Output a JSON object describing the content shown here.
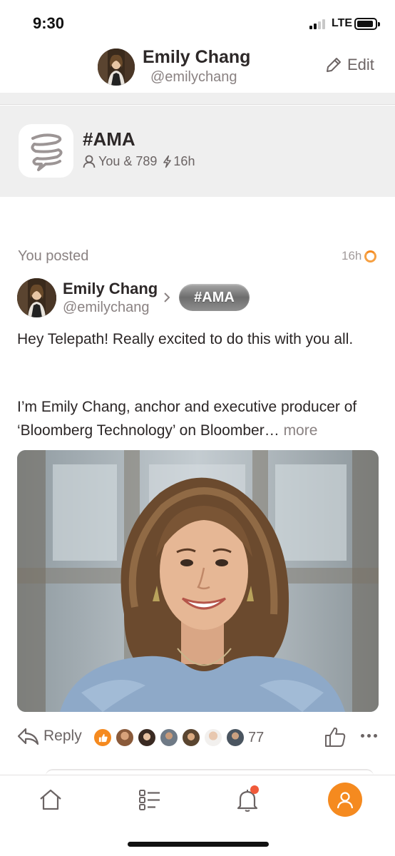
{
  "status_bar": {
    "time": "9:30",
    "network": "LTE"
  },
  "header": {
    "name": "Emily Chang",
    "handle": "@emilychang",
    "edit_label": "Edit"
  },
  "topic": {
    "name": "#AMA",
    "members": "You & 789",
    "age": "16h"
  },
  "post": {
    "context_label": "You posted",
    "time": "16h",
    "author_name": "Emily Chang",
    "author_handle": "@emilychang",
    "topic_chip": "#AMA",
    "paragraph_1": "Hey Telepath! Really excited to do this with you all.",
    "paragraph_2": "I’m Emily Chang, anchor and executive producer of ‘Bloomberg Technology’ on Bloomber…",
    "more_label": "more",
    "reply_label": "Reply",
    "reaction_count": "77"
  },
  "tab_bar": {
    "items": [
      "home",
      "feed",
      "notifications",
      "profile"
    ]
  },
  "colors": {
    "accent": "#f58a1f",
    "banner_bg": "#efefef",
    "notification_dot": "#f05a3a"
  }
}
